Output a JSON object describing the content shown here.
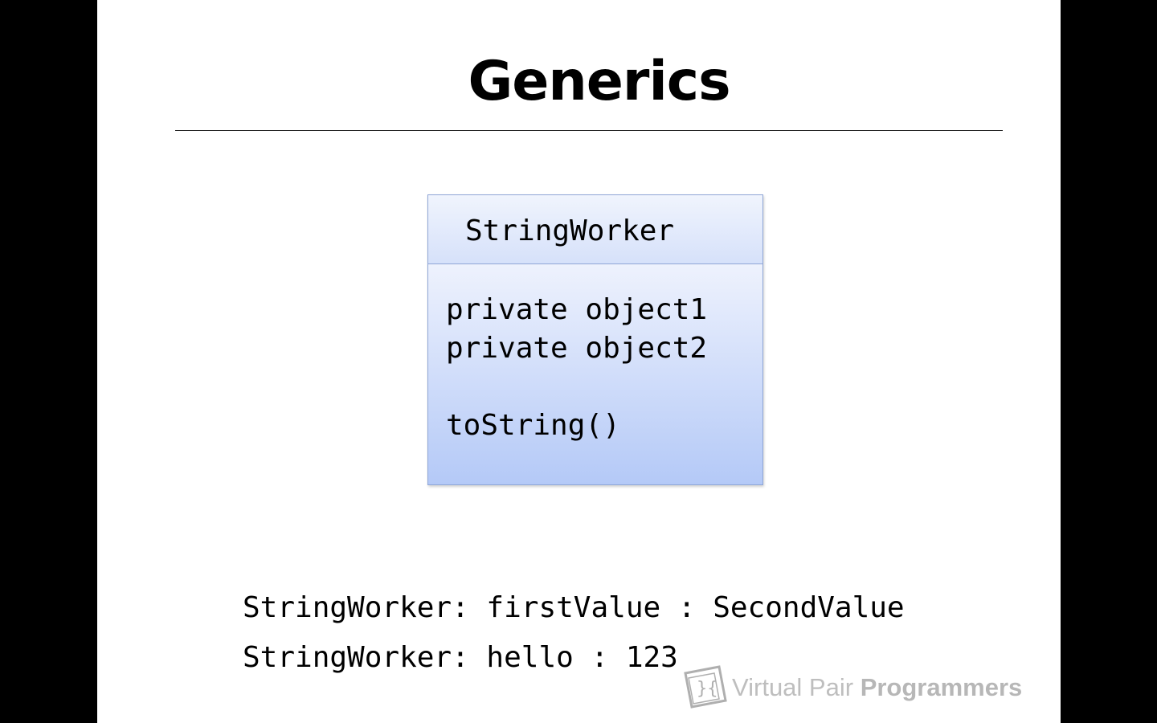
{
  "slide": {
    "title": "Generics"
  },
  "uml": {
    "class_name": "StringWorker",
    "attributes": [
      "private object1",
      "private object2"
    ],
    "methods": [
      "toString()"
    ]
  },
  "output": {
    "lines": [
      "StringWorker: firstValue : SecondValue",
      "StringWorker: hello : 123"
    ]
  },
  "watermark": {
    "name_light": "Virtual Pair",
    "name_bold": "Programmers",
    "logo_icon": "brackets-logo-icon"
  },
  "colors": {
    "box_border": "#8fa6d6",
    "box_gradient_top": "#eef2fd",
    "box_gradient_bottom": "#b4c9f7"
  }
}
